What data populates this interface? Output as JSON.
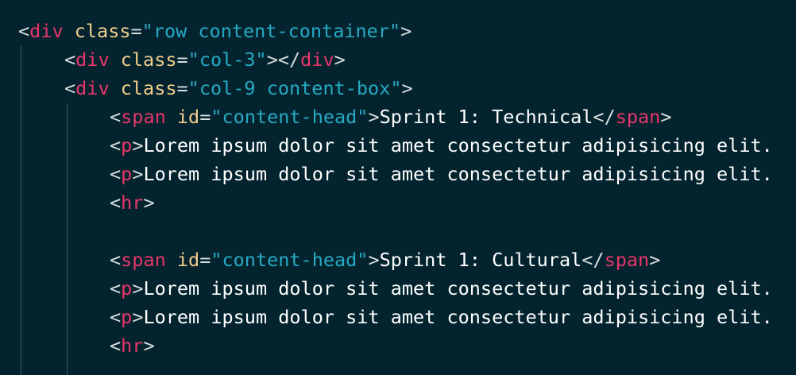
{
  "colors": {
    "background": "#03242e",
    "tag": "#e8366b",
    "attribute": "#f2cd8c",
    "string": "#27a9c4",
    "text": "#ffffff",
    "bracket": "#d8dee0"
  },
  "code_lines": [
    {
      "tokens": [
        {
          "type": "bracket",
          "text": "<"
        },
        {
          "type": "tag",
          "text": "div"
        },
        {
          "type": "text",
          "text": " "
        },
        {
          "type": "attr",
          "text": "class"
        },
        {
          "type": "eq",
          "text": "="
        },
        {
          "type": "str",
          "text": "\"row content-container\""
        },
        {
          "type": "bracket",
          "text": ">"
        }
      ]
    },
    {
      "tokens": [
        {
          "type": "bracket",
          "text": "<"
        },
        {
          "type": "tag",
          "text": "div"
        },
        {
          "type": "text",
          "text": " "
        },
        {
          "type": "attr",
          "text": "class"
        },
        {
          "type": "eq",
          "text": "="
        },
        {
          "type": "str",
          "text": "\"col-3\""
        },
        {
          "type": "bracket",
          "text": "></"
        },
        {
          "type": "tag",
          "text": "div"
        },
        {
          "type": "bracket",
          "text": ">"
        }
      ]
    },
    {
      "tokens": [
        {
          "type": "bracket",
          "text": "<"
        },
        {
          "type": "tag",
          "text": "div"
        },
        {
          "type": "text",
          "text": " "
        },
        {
          "type": "attr",
          "text": "class"
        },
        {
          "type": "eq",
          "text": "="
        },
        {
          "type": "str",
          "text": "\"col-9 content-box\""
        },
        {
          "type": "bracket",
          "text": ">"
        }
      ]
    },
    {
      "tokens": [
        {
          "type": "bracket",
          "text": "<"
        },
        {
          "type": "tag",
          "text": "span"
        },
        {
          "type": "text",
          "text": " "
        },
        {
          "type": "attr",
          "text": "id"
        },
        {
          "type": "eq",
          "text": "="
        },
        {
          "type": "str",
          "text": "\"content-head\""
        },
        {
          "type": "bracket",
          "text": ">"
        },
        {
          "type": "text",
          "text": "Sprint 1: Technical"
        },
        {
          "type": "bracket",
          "text": "</"
        },
        {
          "type": "tag",
          "text": "span"
        },
        {
          "type": "bracket",
          "text": ">"
        }
      ]
    },
    {
      "tokens": [
        {
          "type": "bracket",
          "text": "<"
        },
        {
          "type": "tag",
          "text": "p"
        },
        {
          "type": "bracket",
          "text": ">"
        },
        {
          "type": "text",
          "text": "Lorem ipsum dolor sit amet consectetur adipisicing elit."
        }
      ]
    },
    {
      "tokens": [
        {
          "type": "bracket",
          "text": "<"
        },
        {
          "type": "tag",
          "text": "p"
        },
        {
          "type": "bracket",
          "text": ">"
        },
        {
          "type": "text",
          "text": "Lorem ipsum dolor sit amet consectetur adipisicing elit."
        }
      ]
    },
    {
      "tokens": [
        {
          "type": "bracket",
          "text": "<"
        },
        {
          "type": "tag",
          "text": "hr"
        },
        {
          "type": "bracket",
          "text": ">"
        }
      ]
    },
    {
      "tokens": []
    },
    {
      "tokens": [
        {
          "type": "bracket",
          "text": "<"
        },
        {
          "type": "tag",
          "text": "span"
        },
        {
          "type": "text",
          "text": " "
        },
        {
          "type": "attr",
          "text": "id"
        },
        {
          "type": "eq",
          "text": "="
        },
        {
          "type": "str",
          "text": "\"content-head\""
        },
        {
          "type": "bracket",
          "text": ">"
        },
        {
          "type": "text",
          "text": "Sprint 1: Cultural"
        },
        {
          "type": "bracket",
          "text": "</"
        },
        {
          "type": "tag",
          "text": "span"
        },
        {
          "type": "bracket",
          "text": ">"
        }
      ]
    },
    {
      "tokens": [
        {
          "type": "bracket",
          "text": "<"
        },
        {
          "type": "tag",
          "text": "p"
        },
        {
          "type": "bracket",
          "text": ">"
        },
        {
          "type": "text",
          "text": "Lorem ipsum dolor sit amet consectetur adipisicing elit."
        }
      ]
    },
    {
      "tokens": [
        {
          "type": "bracket",
          "text": "<"
        },
        {
          "type": "tag",
          "text": "p"
        },
        {
          "type": "bracket",
          "text": ">"
        },
        {
          "type": "text",
          "text": "Lorem ipsum dolor sit amet consectetur adipisicing elit."
        }
      ]
    },
    {
      "tokens": [
        {
          "type": "bracket",
          "text": "<"
        },
        {
          "type": "tag",
          "text": "hr"
        },
        {
          "type": "bracket",
          "text": ">"
        }
      ]
    }
  ]
}
